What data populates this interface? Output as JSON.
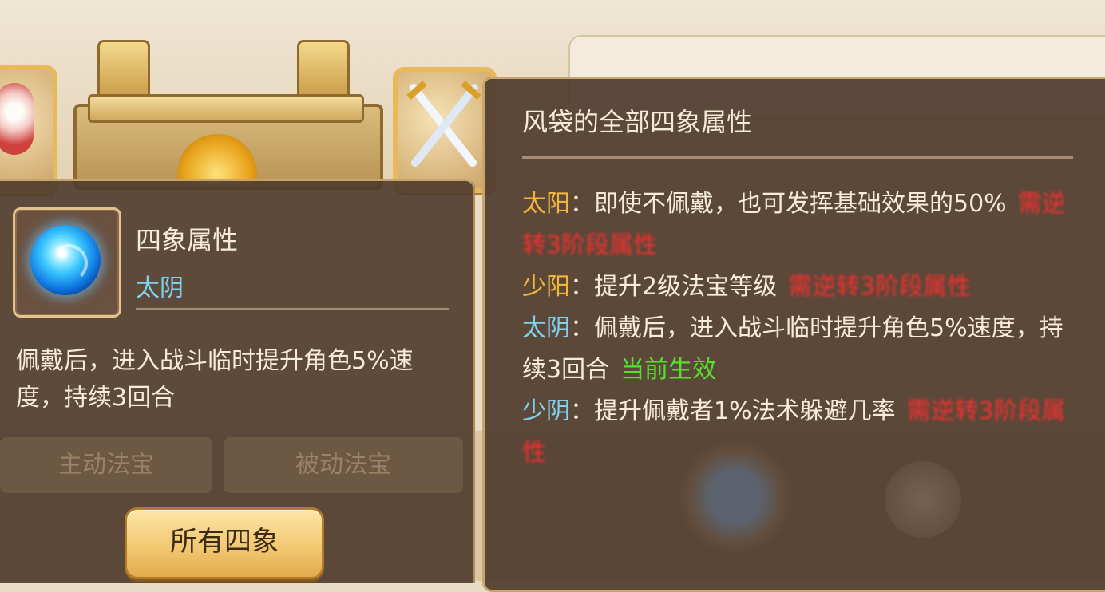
{
  "background": {
    "tab_active": "主动法宝",
    "tab_passive": "被动法宝"
  },
  "item_tooltip": {
    "title": "四象属性",
    "subtitle": "太阴",
    "description": "佩戴后，进入战斗临时提升角色5%速度，持续3回合",
    "button_label": "所有四象"
  },
  "attributes_tooltip": {
    "title": "风袋的全部四象属性",
    "entries": [
      {
        "tag": "太阳",
        "sep": "：",
        "text": "即使不佩戴，也可发挥基础效果的50%",
        "status": "需逆转3阶段属性",
        "status_kind": "locked"
      },
      {
        "tag": "少阳",
        "sep": "：",
        "text": "提升2级法宝等级",
        "status": "需逆转3阶段属性",
        "status_kind": "locked"
      },
      {
        "tag": "太阴",
        "sep": "：",
        "text": "佩戴后，进入战斗临时提升角色5%速度，持续3回合",
        "status": "当前生效",
        "status_kind": "active"
      },
      {
        "tag": "少阴",
        "sep": "：",
        "text": "提升佩戴者1%法术躲避几率",
        "status": "需逆转3阶段属性",
        "status_kind": "locked"
      }
    ]
  },
  "colors": {
    "yang_tag": "#f2b43c",
    "yin_tag": "#7fd1ee",
    "locked_status": "#ff2f2f",
    "active_status": "#57e02b",
    "panel_bg": "#4e3a2c",
    "button_bg": "#f1c56e"
  },
  "icons": {
    "item": "blue-wind-orb-icon",
    "background_slot": "crossed-swords-icon"
  }
}
